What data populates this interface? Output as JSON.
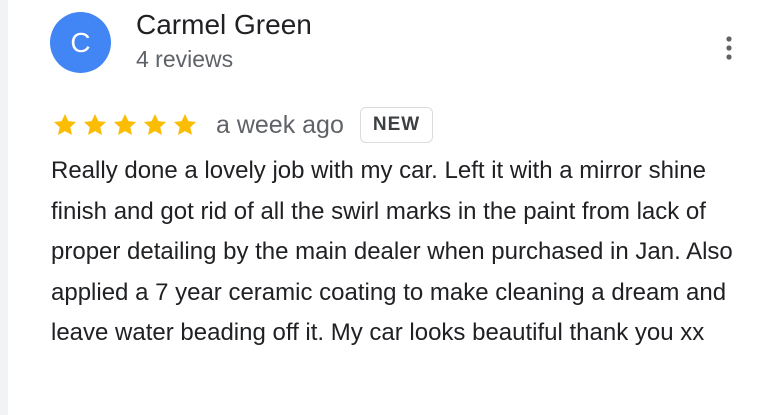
{
  "review": {
    "avatar_letter": "C",
    "avatar_color": "#4285f4",
    "reviewer_name": "Carmel Green",
    "reviewer_meta": "4 reviews",
    "more_icon": "more-vertical-icon",
    "rating": 5,
    "star_color": "#fbbc04",
    "date": "a week ago",
    "badge": "NEW",
    "text": "Really done a lovely job with my car. Left it with a mirror shine finish and got rid of all the swirl marks in the paint from lack of proper detailing by the main dealer when purchased in Jan. Also applied a 7 year ceramic coating to make cleaning a dream and leave water beading off it. My car looks beautiful thank you xx"
  }
}
